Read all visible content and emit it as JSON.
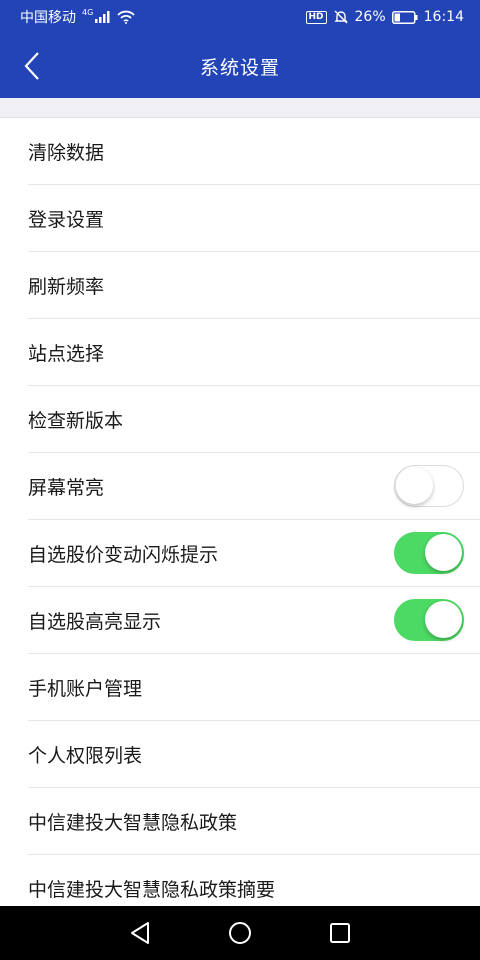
{
  "status_bar": {
    "carrier": "中国移动",
    "network": "4G",
    "battery": "26%",
    "time": "16:14",
    "hd_badge": "HD",
    "icons": [
      "signal-icon",
      "wifi-icon",
      "mute-icon",
      "battery-icon"
    ]
  },
  "header": {
    "title": "系统设置",
    "background": "#2244b6"
  },
  "settings": {
    "items": [
      {
        "label": "清除数据"
      },
      {
        "label": "登录设置"
      },
      {
        "label": "刷新频率"
      },
      {
        "label": "站点选择"
      },
      {
        "label": "检查新版本"
      },
      {
        "label": "屏幕常亮",
        "toggle": false
      },
      {
        "label": "自选股价变动闪烁提示",
        "toggle": true
      },
      {
        "label": "自选股高亮显示",
        "toggle": true
      },
      {
        "label": "手机账户管理"
      },
      {
        "label": "个人权限列表"
      },
      {
        "label": "中信建投大智慧隐私政策"
      },
      {
        "label": "中信建投大智慧隐私政策摘要"
      }
    ]
  },
  "colors": {
    "toggle_on": "#4cd964",
    "toggle_off_border": "#dcdcdc"
  },
  "nav_bar": {
    "icons": [
      "back-triangle-icon",
      "home-circle-icon",
      "recents-square-icon"
    ]
  }
}
